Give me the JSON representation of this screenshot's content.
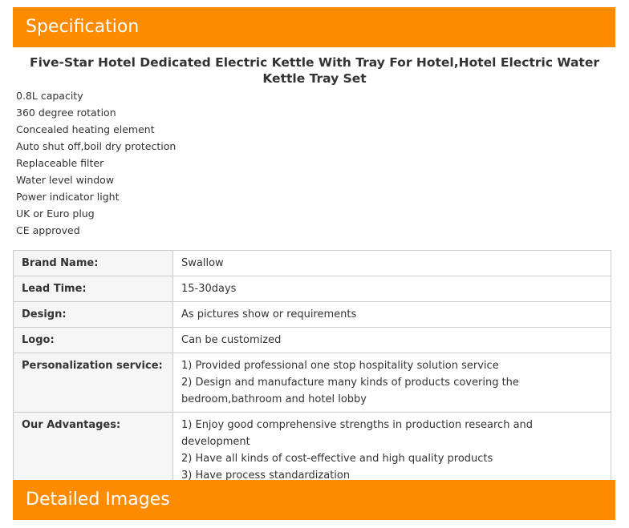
{
  "specification_header": "Specification",
  "product_title": "Five-Star Hotel Dedicated Electric Kettle With Tray For Hotel,Hotel Electric Water Kettle Tray Set",
  "features": [
    "0.8L capacity",
    "360 degree rotation",
    "Concealed heating element",
    "Auto shut off,boil dry protection",
    "Replaceable filter",
    "Water level window",
    "Power indicator light",
    "UK or Euro plug",
    "CE approved"
  ],
  "spec_table": [
    {
      "label": "Brand Name:",
      "values": [
        "Swallow"
      ]
    },
    {
      "label": "Lead Time:",
      "values": [
        "15-30days"
      ]
    },
    {
      "label": "Design:",
      "values": [
        "As pictures show or requirements"
      ]
    },
    {
      "label": "Logo:",
      "values": [
        "Can be customized"
      ]
    },
    {
      "label": "Personalization service:",
      "values": [
        "1) Provided professional one stop hospitality solution service",
        "2) Design and manufacture many kinds of products covering the bedroom,bathroom and hotel lobby"
      ]
    },
    {
      "label": "Our Advantages:",
      "values": [
        "1) Enjoy good comprehensive strengths in production research and development",
        "2) Have all kinds of cost-effective and high quality products",
        "3) Have process standardization"
      ]
    }
  ],
  "detailed_images_header": "Detailed Images",
  "colors": {
    "accent": "#ff8b00",
    "text": "#333333",
    "border": "#cccccc"
  }
}
